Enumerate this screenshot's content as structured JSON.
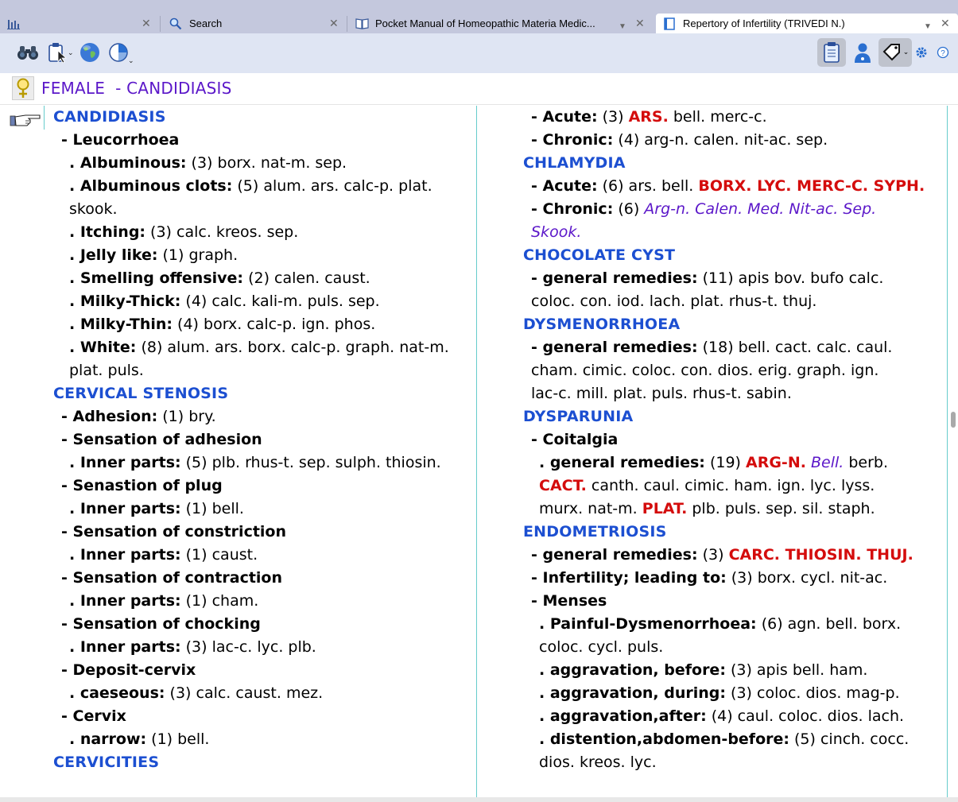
{
  "tabs": [
    {
      "label": "",
      "icon": "bar-chart-icon"
    },
    {
      "label": "Search",
      "icon": "search-icon"
    },
    {
      "label": "Pocket Manual of Homeopathic Materia Medic...",
      "icon": "book-icon"
    },
    {
      "label": "Repertory of Infertility (TRIVEDI  N.)",
      "icon": "book-icon"
    }
  ],
  "toolbar": {
    "left_icons": [
      "binoculars-icon",
      "clipboard-cursor-icon",
      "globe-icon",
      "pie-chart-icon"
    ],
    "right_icons": [
      "clipboard-list-icon",
      "doctor-icon",
      "tag-icon",
      "gear-icon",
      "help-icon"
    ]
  },
  "header": {
    "icon": "venus-icon",
    "title": "FEMALE  - CANDIDIASIS"
  },
  "colors": {
    "heading": "#1c4fd1",
    "grade3": "#d40c0c",
    "grade2": "#5b17c9",
    "title": "#5b17c9"
  },
  "left_column": [
    {
      "type": "heading",
      "text": "CANDIDIASIS"
    },
    {
      "type": "entry",
      "level": 1,
      "label": "- Leucorrhoea"
    },
    {
      "type": "entry",
      "level": 2,
      "label": ". Albuminous:",
      "count": " (3)",
      "remedies": [
        {
          "t": " borx. nat-m. sep."
        }
      ]
    },
    {
      "type": "entry",
      "level": 2,
      "label": ". Albuminous clots:",
      "count": " (5)",
      "remedies": [
        {
          "t": " alum. ars. calc-p. plat."
        }
      ],
      "cont": "skook."
    },
    {
      "type": "entry",
      "level": 2,
      "label": ". Itching:",
      "count": " (3)",
      "remedies": [
        {
          "t": " calc. kreos. sep."
        }
      ]
    },
    {
      "type": "entry",
      "level": 2,
      "label": ". Jelly like:",
      "count": " (1)",
      "remedies": [
        {
          "t": " graph."
        }
      ]
    },
    {
      "type": "entry",
      "level": 2,
      "label": ". Smelling offensive:",
      "count": " (2)",
      "remedies": [
        {
          "t": " calen. caust."
        }
      ]
    },
    {
      "type": "entry",
      "level": 2,
      "label": ". Milky-Thick:",
      "count": " (4)",
      "remedies": [
        {
          "t": " calc. kali-m. puls. sep."
        }
      ]
    },
    {
      "type": "entry",
      "level": 2,
      "label": ". Milky-Thin:",
      "count": " (4)",
      "remedies": [
        {
          "t": " borx. calc-p. ign. phos."
        }
      ]
    },
    {
      "type": "entry",
      "level": 2,
      "label": ". White:",
      "count": " (8)",
      "remedies": [
        {
          "t": " alum. ars. borx. calc-p. graph. nat-m."
        }
      ],
      "cont": "plat. puls."
    },
    {
      "type": "heading",
      "text": "CERVICAL STENOSIS"
    },
    {
      "type": "entry",
      "level": 1,
      "label": "- Adhesion:",
      "count": " (1)",
      "remedies": [
        {
          "t": " bry."
        }
      ]
    },
    {
      "type": "entry",
      "level": 1,
      "label": "- Sensation of adhesion"
    },
    {
      "type": "entry",
      "level": 2,
      "label": ". Inner parts:",
      "count": " (5)",
      "remedies": [
        {
          "t": " plb. rhus-t. sep. sulph. thiosin."
        }
      ]
    },
    {
      "type": "entry",
      "level": 1,
      "label": "- Senastion of plug"
    },
    {
      "type": "entry",
      "level": 2,
      "label": ". Inner parts:",
      "count": " (1)",
      "remedies": [
        {
          "t": " bell."
        }
      ]
    },
    {
      "type": "entry",
      "level": 1,
      "label": "- Sensation of constriction"
    },
    {
      "type": "entry",
      "level": 2,
      "label": ". Inner parts:",
      "count": " (1)",
      "remedies": [
        {
          "t": " caust."
        }
      ]
    },
    {
      "type": "entry",
      "level": 1,
      "label": "- Sensation of contraction"
    },
    {
      "type": "entry",
      "level": 2,
      "label": ". Inner parts:",
      "count": " (1)",
      "remedies": [
        {
          "t": " cham."
        }
      ]
    },
    {
      "type": "entry",
      "level": 1,
      "label": "- Sensation of chocking"
    },
    {
      "type": "entry",
      "level": 2,
      "label": ". Inner parts:",
      "count": " (3)",
      "remedies": [
        {
          "t": " lac-c. lyc. plb."
        }
      ]
    },
    {
      "type": "entry",
      "level": 1,
      "label": "- Deposit-cervix"
    },
    {
      "type": "entry",
      "level": 2,
      "label": ". caeseous:",
      "count": " (3)",
      "remedies": [
        {
          "t": " calc. caust. mez."
        }
      ]
    },
    {
      "type": "entry",
      "level": 1,
      "label": "- Cervix"
    },
    {
      "type": "entry",
      "level": 2,
      "label": ". narrow:",
      "count": " (1)",
      "remedies": [
        {
          "t": " bell."
        }
      ]
    },
    {
      "type": "heading",
      "text": "CERVICITIES"
    }
  ],
  "right_column": [
    {
      "type": "entry",
      "level": 1,
      "label": "- Acute:",
      "count": " (3)",
      "remedies": [
        {
          "t": " "
        },
        {
          "t": "ARS.",
          "g": "red"
        },
        {
          "t": " bell. merc-c."
        }
      ]
    },
    {
      "type": "entry",
      "level": 1,
      "label": "- Chronic:",
      "count": " (4)",
      "remedies": [
        {
          "t": " arg-n. calen. nit-ac. sep."
        }
      ]
    },
    {
      "type": "heading",
      "text": "CHLAMYDIA"
    },
    {
      "type": "entry",
      "level": 1,
      "label": "- Acute:",
      "count": " (6)",
      "remedies": [
        {
          "t": " ars. bell. "
        },
        {
          "t": "BORX. LYC. MERC-C. SYPH.",
          "g": "red"
        }
      ]
    },
    {
      "type": "entry",
      "level": 1,
      "label": "- Chronic:",
      "count": " (6)",
      "remedies": [
        {
          "t": " "
        },
        {
          "t": "Arg-n. Calen. Med. Nit-ac. Sep.",
          "g": "purple"
        }
      ],
      "cont": "Skook.",
      "cont_g": "purple"
    },
    {
      "type": "heading",
      "text": "CHOCOLATE CYST"
    },
    {
      "type": "entry",
      "level": 1,
      "label": "- general remedies:",
      "count": " (11)",
      "remedies": [
        {
          "t": " apis bov. bufo calc."
        }
      ],
      "cont": "coloc. con. iod. lach. plat. rhus-t. thuj."
    },
    {
      "type": "heading",
      "text": "DYSMENORRHOEA"
    },
    {
      "type": "entry",
      "level": 1,
      "label": "- general remedies:",
      "count": " (18)",
      "remedies": [
        {
          "t": " bell. cact. calc. caul."
        }
      ],
      "cont": "cham. cimic. coloc. con. dios. erig. graph. ign.",
      "cont2": "lac-c. mill. plat. puls. rhus-t. sabin."
    },
    {
      "type": "heading",
      "text": "DYSPARUNIA"
    },
    {
      "type": "entry",
      "level": 1,
      "label": "- Coitalgia"
    },
    {
      "type": "entry",
      "level": 2,
      "label": ". general remedies:",
      "count": " (19)",
      "remedies": [
        {
          "t": " "
        },
        {
          "t": "ARG-N.",
          "g": "red"
        },
        {
          "t": " "
        },
        {
          "t": "Bell.",
          "g": "purple"
        },
        {
          "t": " berb."
        }
      ],
      "cont_parts": [
        {
          "t": "CACT.",
          "g": "red"
        },
        {
          "t": " canth. caul. cimic. ham. ign. lyc. lyss."
        }
      ],
      "cont2_parts": [
        {
          "t": "murx. nat-m. "
        },
        {
          "t": "PLAT.",
          "g": "red"
        },
        {
          "t": " plb. puls. sep. sil. staph."
        }
      ]
    },
    {
      "type": "heading",
      "text": "ENDOMETRIOSIS"
    },
    {
      "type": "entry",
      "level": 1,
      "label": "- general remedies:",
      "count": " (3)",
      "remedies": [
        {
          "t": " "
        },
        {
          "t": "CARC. THIOSIN. THUJ.",
          "g": "red"
        }
      ]
    },
    {
      "type": "entry",
      "level": 1,
      "label": "- Infertility; leading to:",
      "count": " (3)",
      "remedies": [
        {
          "t": " borx. cycl. nit-ac."
        }
      ]
    },
    {
      "type": "entry",
      "level": 1,
      "label": "- Menses"
    },
    {
      "type": "entry",
      "level": 2,
      "label": ". Painful-Dysmenorrhoea:",
      "count": " (6)",
      "remedies": [
        {
          "t": " agn. bell. borx."
        }
      ],
      "cont": "coloc. cycl. puls."
    },
    {
      "type": "entry",
      "level": 2,
      "label": ". aggravation, before:",
      "count": " (3)",
      "remedies": [
        {
          "t": " apis bell. ham."
        }
      ]
    },
    {
      "type": "entry",
      "level": 2,
      "label": ". aggravation, during:",
      "count": " (3)",
      "remedies": [
        {
          "t": " coloc. dios. mag-p."
        }
      ]
    },
    {
      "type": "entry",
      "level": 2,
      "label": ". aggravation,after:",
      "count": " (4)",
      "remedies": [
        {
          "t": " caul. coloc. dios. lach."
        }
      ]
    },
    {
      "type": "entry",
      "level": 2,
      "label": ". distention,abdomen-before:",
      "count": " (5)",
      "remedies": [
        {
          "t": " cinch. cocc."
        }
      ],
      "cont": "dios. kreos. lyc."
    }
  ]
}
